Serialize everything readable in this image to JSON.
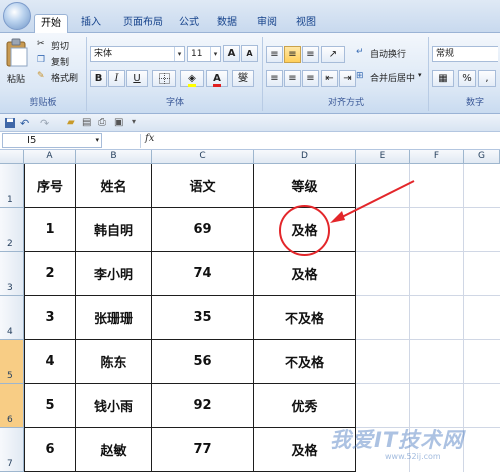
{
  "ribbon": {
    "tabs": [
      "开始",
      "插入",
      "页面布局",
      "公式",
      "数据",
      "审阅",
      "视图"
    ],
    "active_tab": "开始",
    "clipboard": {
      "paste": "粘贴",
      "cut": "剪切",
      "copy": "复制",
      "format_painter": "格式刷",
      "group_label": "剪贴板"
    },
    "font": {
      "name": "宋体",
      "size": "11",
      "grow": "A",
      "shrink": "A",
      "bold": "B",
      "italic": "I",
      "underline": "U",
      "font_color_label": "A",
      "phonetic": "燮",
      "group_label": "字体"
    },
    "alignment": {
      "wrap_text": "自动换行",
      "merge_center": "合并后居中",
      "group_label": "对齐方式"
    },
    "number": {
      "format": "常规",
      "percent": "%",
      "comma": ",",
      "group_label": "数字"
    }
  },
  "formula_bar": {
    "name_box": "I5",
    "fx": "fx",
    "content": ""
  },
  "sheet": {
    "columns": [
      "A",
      "B",
      "C",
      "D",
      "E",
      "F",
      "G"
    ],
    "row_numbers": [
      "1",
      "2",
      "3",
      "4",
      "5",
      "6",
      "7"
    ],
    "headers": [
      "序号",
      "姓名",
      "语文",
      "等级"
    ],
    "rows": [
      [
        "1",
        "韩自明",
        "69",
        "及格"
      ],
      [
        "2",
        "李小明",
        "74",
        "及格"
      ],
      [
        "3",
        "张珊珊",
        "35",
        "不及格"
      ],
      [
        "4",
        "陈东",
        "56",
        "不及格"
      ],
      [
        "5",
        "钱小雨",
        "92",
        "优秀"
      ],
      [
        "6",
        "赵敏",
        "77",
        "及格"
      ]
    ]
  },
  "watermark": {
    "text": "我爱IT技术网",
    "url": "www.52ij.com"
  },
  "colors": {
    "annotation": "#e3262a",
    "header_bg": "#e1e9f3",
    "selected_row": "#f8cd85"
  }
}
